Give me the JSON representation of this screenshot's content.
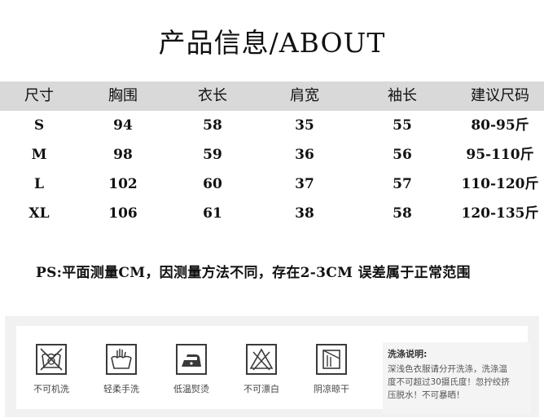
{
  "title": "产品信息/ABOUT",
  "table": {
    "headers": [
      "尺寸",
      "胸围",
      "衣长",
      "肩宽",
      "袖长",
      "建议尺码"
    ],
    "rows": [
      [
        "S",
        "94",
        "58",
        "35",
        "55",
        "80-95斤"
      ],
      [
        "M",
        "98",
        "59",
        "36",
        "56",
        "95-110斤"
      ],
      [
        "L",
        "102",
        "60",
        "37",
        "57",
        "110-120斤"
      ],
      [
        "XL",
        "106",
        "61",
        "38",
        "58",
        "120-135斤"
      ]
    ]
  },
  "note": "PS:平面测量CM，因测量方法不同，存在2-3CM 误差属于正常范围",
  "care": {
    "icons": [
      {
        "icon": "no-machine-wash-icon",
        "label": "不可机洗"
      },
      {
        "icon": "hand-wash-icon",
        "label": "轻柔手洗"
      },
      {
        "icon": "low-iron-icon",
        "label": "低温熨烫"
      },
      {
        "icon": "no-bleach-icon",
        "label": "不可漂白"
      },
      {
        "icon": "shade-dry-icon",
        "label": "阴凉晾干"
      }
    ],
    "wash_title": "洗涤说明:",
    "wash_lines": [
      "深浅色衣服请分开洗涤，洗涤温",
      "度不可超过30摄氏度！忽拧绞挤",
      "压脱水！不可暴晒！"
    ]
  }
}
